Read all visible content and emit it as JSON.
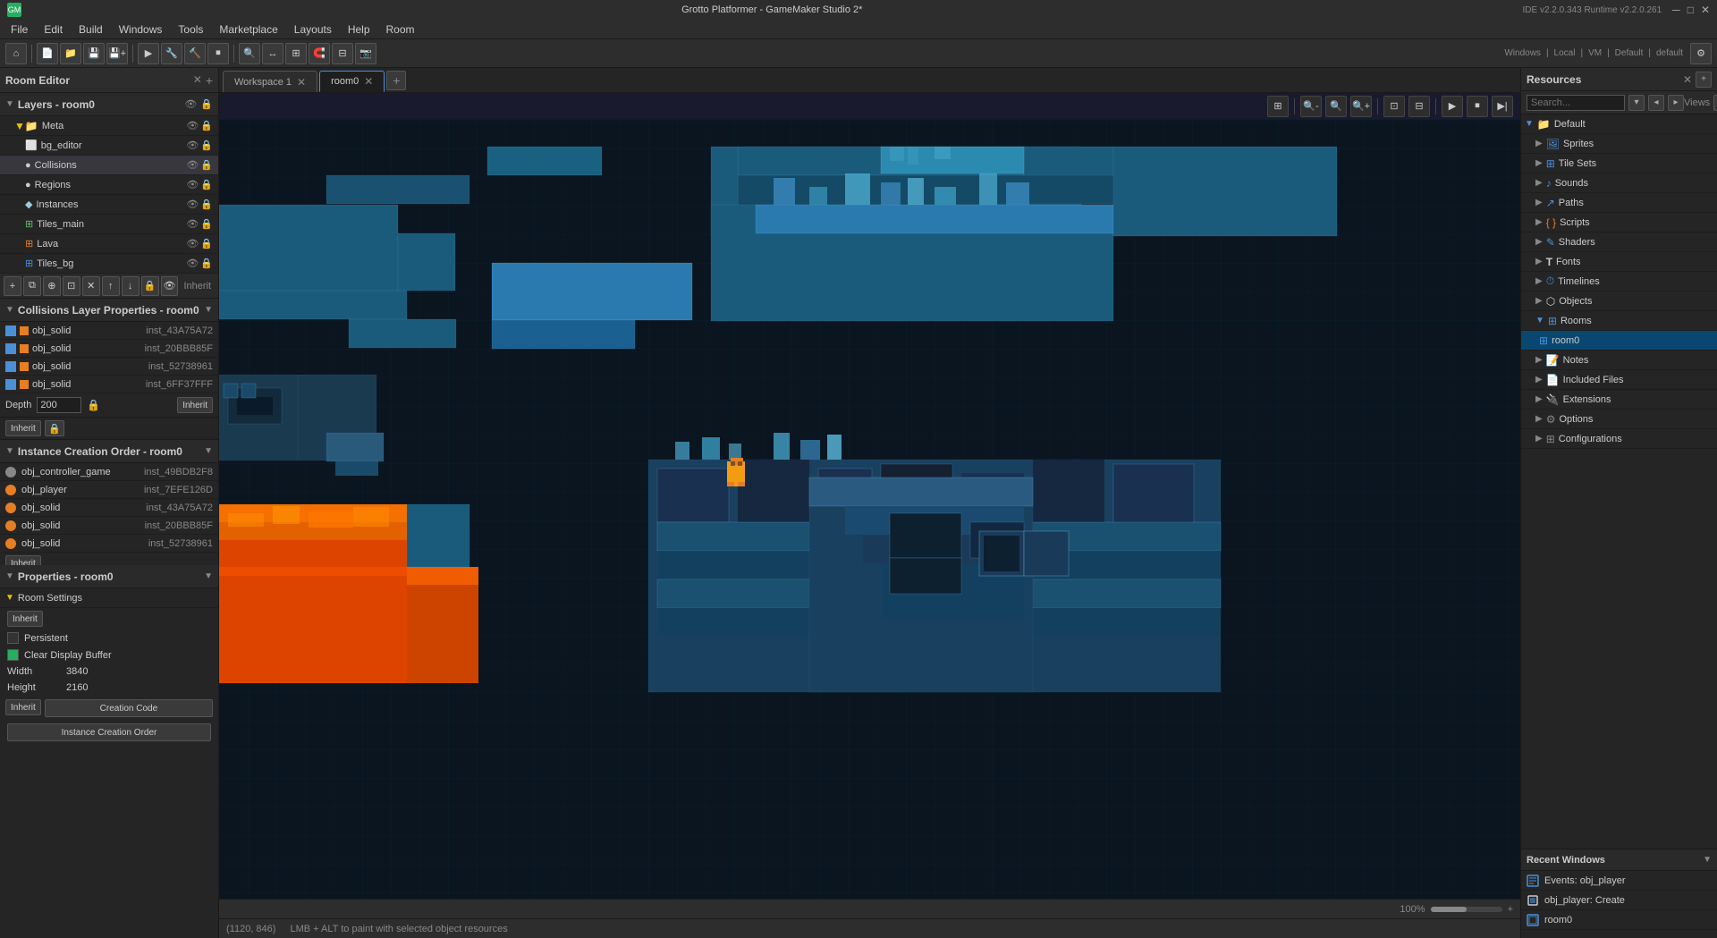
{
  "window": {
    "title": "Grotto Platformer - GameMaker Studio 2*",
    "ide_version": "IDE v2.2.0.343 Runtime v2.2.0.261",
    "controls": [
      "─",
      "□",
      "✕"
    ]
  },
  "menubar": {
    "items": [
      "File",
      "Edit",
      "Build",
      "Windows",
      "Tools",
      "Marketplace",
      "Layouts",
      "Help",
      "Room"
    ]
  },
  "tabs_bar": {
    "workspace_tab": "Workspace 1",
    "room_tab": "room0",
    "add_tab": "+"
  },
  "room_editor": {
    "panel_title": "Room Editor",
    "layers_title": "Layers - room0",
    "layers": [
      {
        "name": "Meta",
        "type": "folder",
        "indent": 0
      },
      {
        "name": "bg_editor",
        "type": "bg",
        "indent": 1
      },
      {
        "name": "Collisions",
        "type": "collision",
        "indent": 1,
        "selected": true
      },
      {
        "name": "Regions",
        "type": "region",
        "indent": 1
      },
      {
        "name": "Instances",
        "type": "instance",
        "indent": 1
      },
      {
        "name": "Tiles_main",
        "type": "tile",
        "indent": 1
      },
      {
        "name": "Lava",
        "type": "tile",
        "indent": 1
      },
      {
        "name": "Tiles_bg",
        "type": "tile",
        "indent": 1
      }
    ],
    "layer_toolbar_buttons": [
      "add",
      "duplicate",
      "merge",
      "group",
      "delete",
      "move-up",
      "move-down",
      "lock",
      "eye"
    ],
    "inherit_label": "Inherit"
  },
  "collision_layer": {
    "title": "Collisions Layer Properties - room0",
    "items": [
      {
        "id": "obj_solid",
        "inst": "inst_43A75A72",
        "checked": true
      },
      {
        "id": "obj_solid",
        "inst": "inst_20BBB85F",
        "checked": true
      },
      {
        "id": "obj_solid",
        "inst": "inst_52738961",
        "checked": true
      },
      {
        "id": "obj_solid",
        "inst": "inst_6FF37FFF",
        "checked": true
      }
    ]
  },
  "depth_section": {
    "label": "Depth",
    "value": "200",
    "inherit_btn": "Inherit"
  },
  "instance_creation_order": {
    "title": "Instance Creation Order - room0",
    "instances": [
      {
        "name": "obj_controller_game",
        "id": "inst_49BDB2F8",
        "color": "#888"
      },
      {
        "name": "obj_player",
        "id": "inst_7EFE126D",
        "color": "#e67e22"
      },
      {
        "name": "obj_solid",
        "id": "inst_43A75A72",
        "color": "#e67e22"
      },
      {
        "name": "obj_solid",
        "id": "inst_20BBB85F",
        "color": "#e67e22"
      },
      {
        "name": "obj_solid",
        "id": "inst_52738961",
        "color": "#e67e22"
      }
    ],
    "inherit_btn": "Inherit"
  },
  "properties": {
    "title": "Properties - room0",
    "room_settings_label": "Room Settings",
    "inherit_btn": "Inherit",
    "persistent_label": "Persistent",
    "clear_display_label": "Clear Display Buffer",
    "width_label": "Width",
    "width_value": "3840",
    "height_label": "Height",
    "height_value": "2160",
    "inherit_btn2": "Inherit",
    "creation_code_btn": "Creation Code",
    "instance_creation_order_btn": "Instance Creation Order"
  },
  "canvas": {
    "toolbar_buttons": [
      "grid",
      "zoom-out",
      "zoom-in",
      "zoom-fit",
      "zoom-actual",
      "play",
      "stop",
      "settings"
    ],
    "zoom_label": "100%"
  },
  "status_bar": {
    "coords": "(1120, 846)",
    "hint": "LMB + ALT to paint with selected object resources"
  },
  "resources_panel": {
    "title": "Resources",
    "views_label": "Views",
    "search_placeholder": "Search...",
    "tree": {
      "default_label": "Default",
      "items": [
        {
          "label": "Sprites",
          "type": "sprite",
          "expanded": false
        },
        {
          "label": "Tile Sets",
          "type": "tileset",
          "expanded": false
        },
        {
          "label": "Sounds",
          "type": "sound",
          "expanded": false
        },
        {
          "label": "Paths",
          "type": "path",
          "expanded": false
        },
        {
          "label": "Scripts",
          "type": "script",
          "expanded": false
        },
        {
          "label": "Shaders",
          "type": "shader",
          "expanded": false
        },
        {
          "label": "Fonts",
          "type": "font",
          "expanded": false
        },
        {
          "label": "Timelines",
          "type": "timeline",
          "expanded": false
        },
        {
          "label": "Objects",
          "type": "object",
          "expanded": false
        },
        {
          "label": "Rooms",
          "type": "room",
          "expanded": true
        },
        {
          "label": "room0",
          "type": "room-item",
          "selected": true,
          "indent": true
        },
        {
          "label": "Notes",
          "type": "note",
          "expanded": false
        },
        {
          "label": "Included Files",
          "type": "file",
          "expanded": false
        },
        {
          "label": "Extensions",
          "type": "ext",
          "expanded": false
        },
        {
          "label": "Options",
          "type": "options",
          "expanded": false
        },
        {
          "label": "Configurations",
          "type": "config",
          "expanded": false
        }
      ]
    }
  },
  "recent_windows": {
    "title": "Recent Windows",
    "items": [
      {
        "label": "Events: obj_player",
        "type": "event"
      },
      {
        "label": "obj_player: Create",
        "type": "object"
      },
      {
        "label": "room0",
        "type": "room"
      }
    ]
  },
  "ide_header": {
    "windows_label": "Windows",
    "local_label": "Local",
    "vm_label": "VM",
    "default_label": "Default",
    "default2_label": "default"
  }
}
